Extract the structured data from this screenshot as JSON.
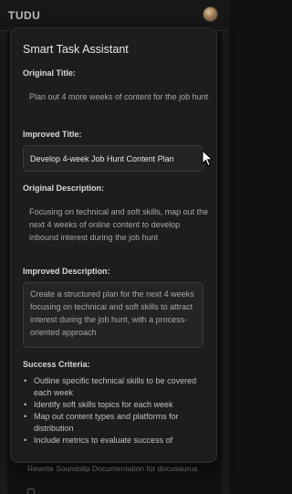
{
  "app": {
    "title": "TUDU"
  },
  "background_task": {
    "text": "Rewrite Soundslip Documentation for docusaurus"
  },
  "assistant": {
    "title": "Smart Task Assistant",
    "original_title": {
      "label": "Original Title:",
      "value": "Plan out 4 more weeks of content for the job hunt"
    },
    "improved_title": {
      "label": "Improved Title:",
      "value": "Develop 4-week Job Hunt Content Plan"
    },
    "original_description": {
      "label": "Original Description:",
      "value": "Focusing on technical and soft skills, map out the next 4 weeks of online content to develop inbound interest during the job hunt"
    },
    "improved_description": {
      "label": "Improved Description:",
      "value": "Create a structured plan for the next 4 weeks focusing on technical and soft skills to attract interest during the job hunt, with a process-oriented approach"
    },
    "success_criteria": {
      "label": "Success Criteria:",
      "items": [
        "Outline specific technical skills to be covered each week",
        "Identify soft skills topics for each week",
        "Map out content types and platforms for distribution",
        "Include metrics to evaluate success of"
      ]
    }
  },
  "icons": {
    "avatar": "user-avatar",
    "cursor": "mouse-pointer-icon"
  },
  "colors": {
    "background": "#111111",
    "panel": "#1d1d1d",
    "field": "#242424",
    "border": "#3a3a3a"
  }
}
